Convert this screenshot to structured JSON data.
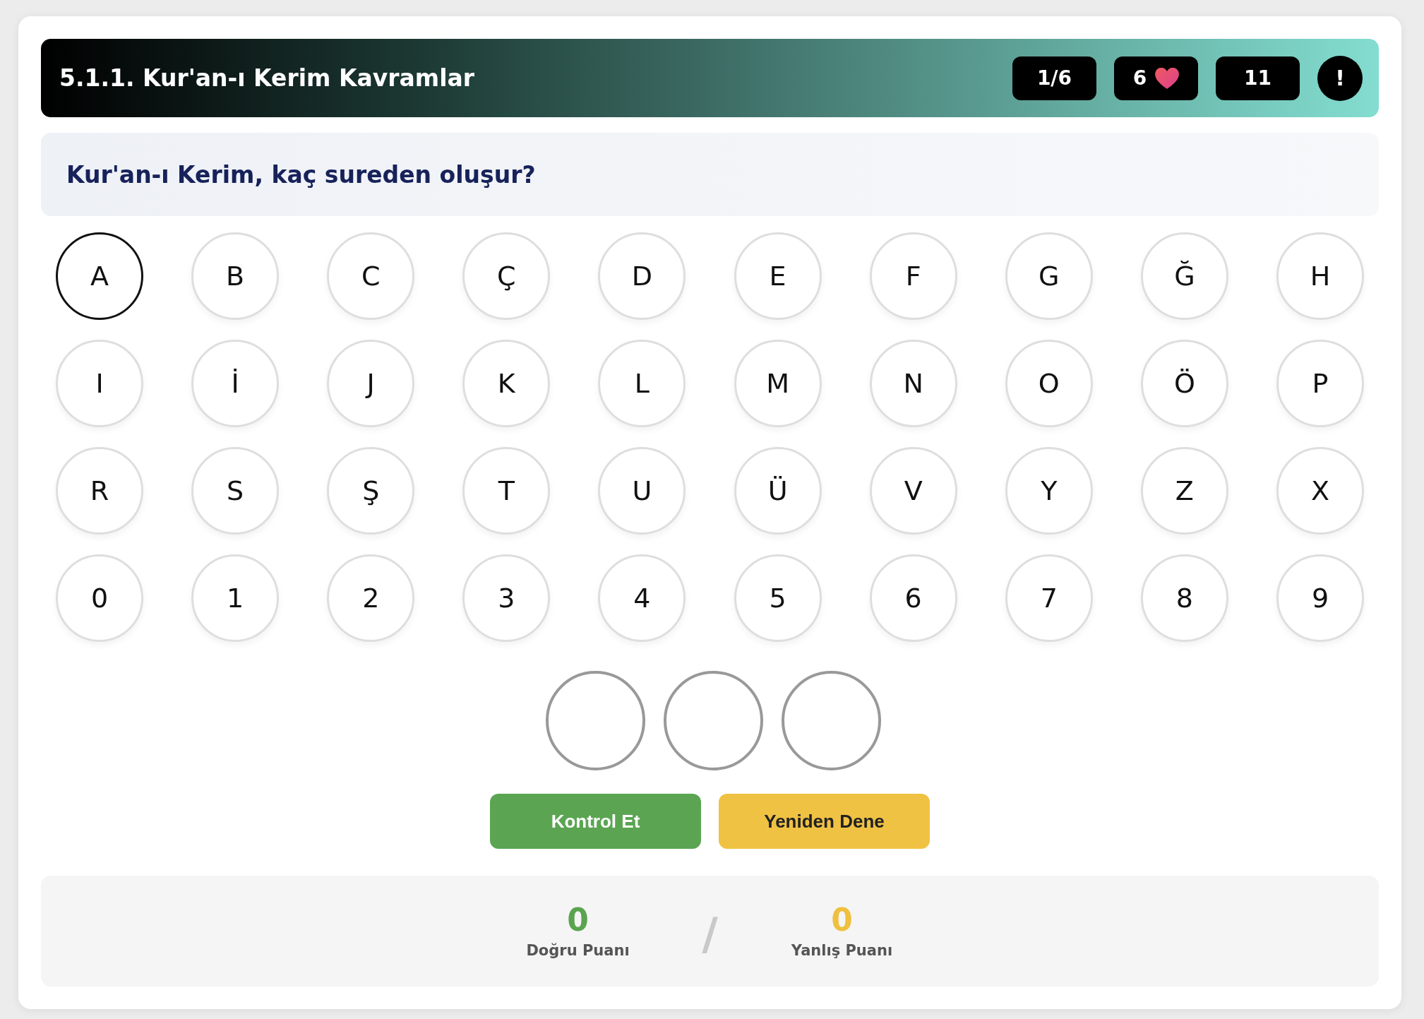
{
  "header": {
    "title": "5.1.1. Kur'an-ı Kerim Kavramlar",
    "badges": [
      {
        "kind": "counter",
        "text": "1/6"
      },
      {
        "kind": "lives",
        "text": "6"
      },
      {
        "kind": "counter",
        "text": "11"
      },
      {
        "kind": "round",
        "text": "!"
      }
    ]
  },
  "question": "Kur'an-ı Kerim, kaç sureden oluşur?",
  "letters": [
    {
      "label": "A",
      "selected": true
    },
    {
      "label": "B",
      "selected": false
    },
    {
      "label": "C",
      "selected": false
    },
    {
      "label": "Ç",
      "selected": false
    },
    {
      "label": "D",
      "selected": false
    },
    {
      "label": "E",
      "selected": false
    },
    {
      "label": "F",
      "selected": false
    },
    {
      "label": "G",
      "selected": false
    },
    {
      "label": "Ğ",
      "selected": false
    },
    {
      "label": "H",
      "selected": false
    },
    {
      "label": "I",
      "selected": false
    },
    {
      "label": "İ",
      "selected": false
    },
    {
      "label": "J",
      "selected": false
    },
    {
      "label": "K",
      "selected": false
    },
    {
      "label": "L",
      "selected": false
    },
    {
      "label": "M",
      "selected": false
    },
    {
      "label": "N",
      "selected": false
    },
    {
      "label": "O",
      "selected": false
    },
    {
      "label": "Ö",
      "selected": false
    },
    {
      "label": "P",
      "selected": false
    },
    {
      "label": "R",
      "selected": false
    },
    {
      "label": "S",
      "selected": false
    },
    {
      "label": "Ş",
      "selected": false
    },
    {
      "label": "T",
      "selected": false
    },
    {
      "label": "U",
      "selected": false
    },
    {
      "label": "Ü",
      "selected": false
    },
    {
      "label": "V",
      "selected": false
    },
    {
      "label": "Y",
      "selected": false
    },
    {
      "label": "Z",
      "selected": false
    },
    {
      "label": "X",
      "selected": false
    },
    {
      "label": "0",
      "selected": false
    },
    {
      "label": "1",
      "selected": false
    },
    {
      "label": "2",
      "selected": false
    },
    {
      "label": "3",
      "selected": false
    },
    {
      "label": "4",
      "selected": false
    },
    {
      "label": "5",
      "selected": false
    },
    {
      "label": "6",
      "selected": false
    },
    {
      "label": "7",
      "selected": false
    },
    {
      "label": "8",
      "selected": false
    },
    {
      "label": "9",
      "selected": false
    }
  ],
  "answer_slots": [
    {
      "filled": false
    },
    {
      "filled": false
    },
    {
      "filled": false
    }
  ],
  "buttons": [
    {
      "kind": "check",
      "label": "Kontrol Et"
    },
    {
      "kind": "retry",
      "label": "Yeniden Dene"
    }
  ],
  "score": {
    "items": [
      {
        "kind": "correct",
        "value": "0",
        "label": "Doğru Puanı"
      },
      {
        "kind": "wrong",
        "value": "0",
        "label": "Yanlış Puanı"
      }
    ],
    "separator": "/"
  }
}
